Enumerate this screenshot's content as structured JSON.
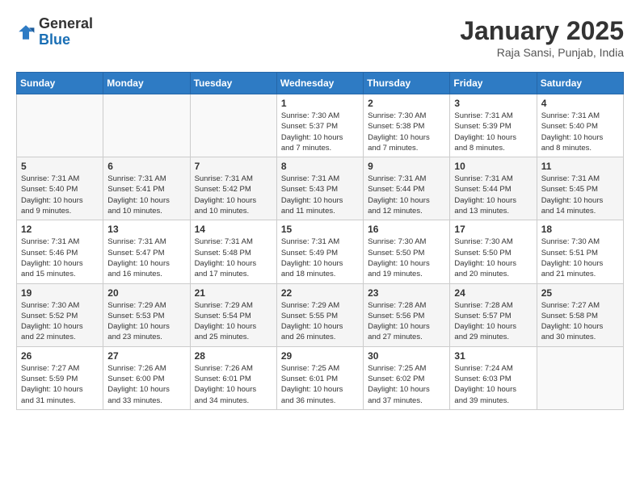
{
  "header": {
    "logo_general": "General",
    "logo_blue": "Blue",
    "month_title": "January 2025",
    "subtitle": "Raja Sansi, Punjab, India"
  },
  "weekdays": [
    "Sunday",
    "Monday",
    "Tuesday",
    "Wednesday",
    "Thursday",
    "Friday",
    "Saturday"
  ],
  "weeks": [
    [
      {
        "day": "",
        "info": ""
      },
      {
        "day": "",
        "info": ""
      },
      {
        "day": "",
        "info": ""
      },
      {
        "day": "1",
        "info": "Sunrise: 7:30 AM\nSunset: 5:37 PM\nDaylight: 10 hours\nand 7 minutes."
      },
      {
        "day": "2",
        "info": "Sunrise: 7:30 AM\nSunset: 5:38 PM\nDaylight: 10 hours\nand 7 minutes."
      },
      {
        "day": "3",
        "info": "Sunrise: 7:31 AM\nSunset: 5:39 PM\nDaylight: 10 hours\nand 8 minutes."
      },
      {
        "day": "4",
        "info": "Sunrise: 7:31 AM\nSunset: 5:40 PM\nDaylight: 10 hours\nand 8 minutes."
      }
    ],
    [
      {
        "day": "5",
        "info": "Sunrise: 7:31 AM\nSunset: 5:40 PM\nDaylight: 10 hours\nand 9 minutes."
      },
      {
        "day": "6",
        "info": "Sunrise: 7:31 AM\nSunset: 5:41 PM\nDaylight: 10 hours\nand 10 minutes."
      },
      {
        "day": "7",
        "info": "Sunrise: 7:31 AM\nSunset: 5:42 PM\nDaylight: 10 hours\nand 10 minutes."
      },
      {
        "day": "8",
        "info": "Sunrise: 7:31 AM\nSunset: 5:43 PM\nDaylight: 10 hours\nand 11 minutes."
      },
      {
        "day": "9",
        "info": "Sunrise: 7:31 AM\nSunset: 5:44 PM\nDaylight: 10 hours\nand 12 minutes."
      },
      {
        "day": "10",
        "info": "Sunrise: 7:31 AM\nSunset: 5:44 PM\nDaylight: 10 hours\nand 13 minutes."
      },
      {
        "day": "11",
        "info": "Sunrise: 7:31 AM\nSunset: 5:45 PM\nDaylight: 10 hours\nand 14 minutes."
      }
    ],
    [
      {
        "day": "12",
        "info": "Sunrise: 7:31 AM\nSunset: 5:46 PM\nDaylight: 10 hours\nand 15 minutes."
      },
      {
        "day": "13",
        "info": "Sunrise: 7:31 AM\nSunset: 5:47 PM\nDaylight: 10 hours\nand 16 minutes."
      },
      {
        "day": "14",
        "info": "Sunrise: 7:31 AM\nSunset: 5:48 PM\nDaylight: 10 hours\nand 17 minutes."
      },
      {
        "day": "15",
        "info": "Sunrise: 7:31 AM\nSunset: 5:49 PM\nDaylight: 10 hours\nand 18 minutes."
      },
      {
        "day": "16",
        "info": "Sunrise: 7:30 AM\nSunset: 5:50 PM\nDaylight: 10 hours\nand 19 minutes."
      },
      {
        "day": "17",
        "info": "Sunrise: 7:30 AM\nSunset: 5:50 PM\nDaylight: 10 hours\nand 20 minutes."
      },
      {
        "day": "18",
        "info": "Sunrise: 7:30 AM\nSunset: 5:51 PM\nDaylight: 10 hours\nand 21 minutes."
      }
    ],
    [
      {
        "day": "19",
        "info": "Sunrise: 7:30 AM\nSunset: 5:52 PM\nDaylight: 10 hours\nand 22 minutes."
      },
      {
        "day": "20",
        "info": "Sunrise: 7:29 AM\nSunset: 5:53 PM\nDaylight: 10 hours\nand 23 minutes."
      },
      {
        "day": "21",
        "info": "Sunrise: 7:29 AM\nSunset: 5:54 PM\nDaylight: 10 hours\nand 25 minutes."
      },
      {
        "day": "22",
        "info": "Sunrise: 7:29 AM\nSunset: 5:55 PM\nDaylight: 10 hours\nand 26 minutes."
      },
      {
        "day": "23",
        "info": "Sunrise: 7:28 AM\nSunset: 5:56 PM\nDaylight: 10 hours\nand 27 minutes."
      },
      {
        "day": "24",
        "info": "Sunrise: 7:28 AM\nSunset: 5:57 PM\nDaylight: 10 hours\nand 29 minutes."
      },
      {
        "day": "25",
        "info": "Sunrise: 7:27 AM\nSunset: 5:58 PM\nDaylight: 10 hours\nand 30 minutes."
      }
    ],
    [
      {
        "day": "26",
        "info": "Sunrise: 7:27 AM\nSunset: 5:59 PM\nDaylight: 10 hours\nand 31 minutes."
      },
      {
        "day": "27",
        "info": "Sunrise: 7:26 AM\nSunset: 6:00 PM\nDaylight: 10 hours\nand 33 minutes."
      },
      {
        "day": "28",
        "info": "Sunrise: 7:26 AM\nSunset: 6:01 PM\nDaylight: 10 hours\nand 34 minutes."
      },
      {
        "day": "29",
        "info": "Sunrise: 7:25 AM\nSunset: 6:01 PM\nDaylight: 10 hours\nand 36 minutes."
      },
      {
        "day": "30",
        "info": "Sunrise: 7:25 AM\nSunset: 6:02 PM\nDaylight: 10 hours\nand 37 minutes."
      },
      {
        "day": "31",
        "info": "Sunrise: 7:24 AM\nSunset: 6:03 PM\nDaylight: 10 hours\nand 39 minutes."
      },
      {
        "day": "",
        "info": ""
      }
    ]
  ]
}
